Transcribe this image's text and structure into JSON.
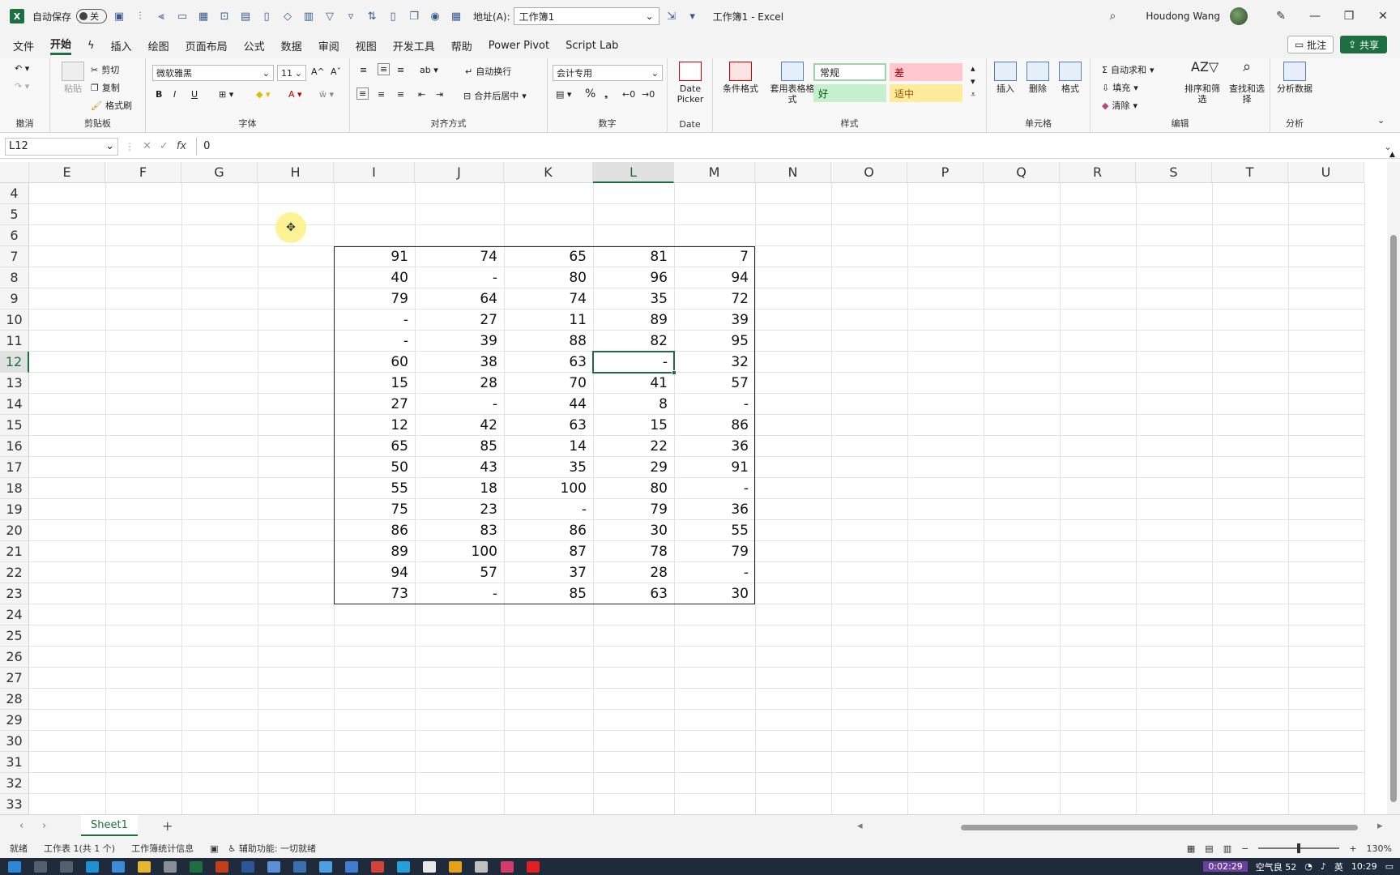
{
  "titlebar": {
    "autosave_label": "自动保存",
    "autosave_state": "关",
    "address_label": "地址(A):",
    "address_value": "工作簿1",
    "doc_title": "工作簿1  -  Excel",
    "user_name": "Houdong Wang"
  },
  "menu": {
    "tabs": [
      "文件",
      "开始",
      "绘图",
      "插入",
      "绘图",
      "页面布局",
      "公式",
      "数据",
      "审阅",
      "视图",
      "开发工具",
      "帮助",
      "Power Pivot",
      "Script Lab"
    ],
    "active_index": 1,
    "comment_label": "批注",
    "share_label": "共享"
  },
  "ribbon": {
    "undo_group": "撤消",
    "clipboard": {
      "paste": "粘贴",
      "cut": "剪切",
      "copy": "复制",
      "format_painter": "格式刷",
      "label": "剪贴板"
    },
    "font": {
      "name": "微软雅黑",
      "size": "11",
      "label": "字体",
      "bold": "B",
      "italic": "I",
      "underline": "U"
    },
    "alignment": {
      "wrap": "自动换行",
      "merge": "合并后居中",
      "label": "对齐方式"
    },
    "number": {
      "format": "会计专用",
      "percent": "%",
      "label": "数字"
    },
    "date": {
      "picker": "Date Picker",
      "label": "Date"
    },
    "styles": {
      "conditional": "条件格式",
      "table": "套用表格格式",
      "normal": "常规",
      "bad": "差",
      "good": "好",
      "neutral": "适中",
      "label": "样式"
    },
    "cells": {
      "insert": "插入",
      "delete": "删除",
      "format": "格式",
      "label": "单元格"
    },
    "editing": {
      "autosum": "自动求和",
      "fill": "填充",
      "clear": "清除",
      "sort": "排序和筛选",
      "find": "查找和选择",
      "label": "编辑"
    },
    "analysis": {
      "analyze": "分析数据",
      "label": "分析"
    }
  },
  "formula_bar": {
    "name_box": "L12",
    "fx": "fx",
    "value": "0"
  },
  "grid": {
    "columns": [
      "E",
      "F",
      "G",
      "H",
      "I",
      "J",
      "K",
      "L",
      "M",
      "N",
      "O",
      "P",
      "Q",
      "R",
      "S",
      "T",
      "U"
    ],
    "selected_column": "L",
    "rows": [
      "4",
      "5",
      "6",
      "7",
      "8",
      "9",
      "10",
      "11",
      "12",
      "13",
      "14",
      "15",
      "16",
      "17",
      "18",
      "19",
      "20",
      "21",
      "22",
      "23",
      "24",
      "25",
      "26",
      "27",
      "28",
      "29",
      "30",
      "31",
      "32",
      "33"
    ],
    "selected_row": "12",
    "data_start_row": 7,
    "data_columns": [
      "I",
      "J",
      "K",
      "L",
      "M"
    ],
    "data": [
      [
        "91",
        "74",
        "65",
        "81",
        "7"
      ],
      [
        "40",
        "-",
        "80",
        "96",
        "94"
      ],
      [
        "79",
        "64",
        "74",
        "35",
        "72"
      ],
      [
        "-",
        "27",
        "11",
        "89",
        "39"
      ],
      [
        "-",
        "39",
        "88",
        "82",
        "95"
      ],
      [
        "60",
        "38",
        "63",
        "-",
        "32"
      ],
      [
        "15",
        "28",
        "70",
        "41",
        "57"
      ],
      [
        "27",
        "-",
        "44",
        "8",
        "-"
      ],
      [
        "12",
        "42",
        "63",
        "15",
        "86"
      ],
      [
        "65",
        "85",
        "14",
        "22",
        "36"
      ],
      [
        "50",
        "43",
        "35",
        "29",
        "91"
      ],
      [
        "55",
        "18",
        "100",
        "80",
        "-"
      ],
      [
        "75",
        "23",
        "-",
        "79",
        "36"
      ],
      [
        "86",
        "83",
        "86",
        "30",
        "55"
      ],
      [
        "89",
        "100",
        "87",
        "78",
        "79"
      ],
      [
        "94",
        "57",
        "37",
        "28",
        "-"
      ],
      [
        "73",
        "-",
        "85",
        "63",
        "30"
      ]
    ]
  },
  "sheets": {
    "tabs": [
      "Sheet1"
    ],
    "active": "Sheet1"
  },
  "status": {
    "ready": "就绪",
    "sheet_info": "工作表 1(共 1 个)",
    "workbook_stats": "工作簿统计信息",
    "accessibility": "辅助功能: 一切就绪",
    "zoom": "130%"
  },
  "taskbar": {
    "recording_time": "0:02:29",
    "weather": "空气良 52",
    "ime": "英",
    "clock": "10:29"
  },
  "colors": {
    "accent": "#1d6f42",
    "bad_fill": "#ffc7ce",
    "good_fill": "#c6efce",
    "neutral_fill": "#ffeb9c"
  }
}
